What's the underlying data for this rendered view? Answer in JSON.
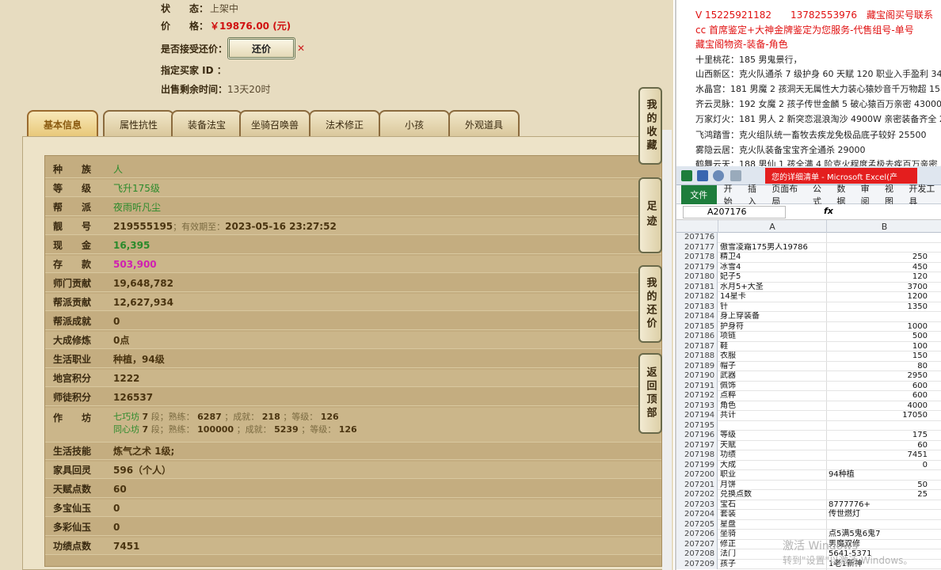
{
  "top": {
    "status_label": "状　　态：",
    "status_value": "上架中",
    "price_label": "价　　格：",
    "price_value": "￥19876.00 (元)",
    "offer_label": "是否接受还价：",
    "offer_button": "还价",
    "buyer_label": "指定买家 ID ：",
    "buyer_value": "",
    "remaining_label": "出售剩余时间：",
    "remaining_value": "13天20时"
  },
  "tabs": [
    "基本信息",
    "属性抗性",
    "装备法宝",
    "坐骑召唤兽",
    "法术修正",
    "小孩",
    "外观道具"
  ],
  "info": {
    "race_label": "种　　族",
    "race": "人",
    "level_label": "等　　级",
    "level": "飞升175级",
    "faction_label": "帮　　派",
    "faction": "夜雨听凡尘",
    "id_label": "靓　　号",
    "id": "219555195",
    "valid_text": "；有效期至：",
    "valid_date": "2023-05-16 23:27:52",
    "cash_label": "现　　金",
    "cash": "16,395",
    "deposit_label": "存　　款",
    "deposit": "503,900",
    "sect_contrib_label": "师门贡献",
    "sect_contrib": "19,648,782",
    "guild_contrib_label": "帮派贡献",
    "guild_contrib": "12,627,934",
    "guild_achieve_label": "帮派成就",
    "guild_achieve": "0",
    "dacheng_label": "大成修炼",
    "dacheng": "0点",
    "life_job_label": "生活职业",
    "life_job": "种植，94级",
    "dungeon_label": "地宫积分",
    "dungeon": "1222",
    "mentor_label": "师徒积分",
    "mentor": "126537",
    "workshop_label": "作　　坊",
    "workshop1_name": "七巧坊",
    "workshop1_lvl": "7",
    "workshop1_seg": "段；熟练：",
    "workshop1_skill": "6287",
    "workshop1_ach_t": "；成就：",
    "workshop1_ach": "218",
    "workshop1_lv_t": "；等级：",
    "workshop1_lv": "126",
    "workshop2_name": "同心坊",
    "workshop2_lvl": "7",
    "workshop2_seg": "段；熟练：",
    "workshop2_skill": "100000",
    "workshop2_ach_t": "；成就：",
    "workshop2_ach": "5239",
    "workshop2_lv_t": "；等级：",
    "workshop2_lv": "126",
    "life_skill_label": "生活技能",
    "life_skill": "炼气之术 1级;",
    "furniture_label": "家具回灵",
    "furniture": "596（个人）",
    "talent_label": "天赋点数",
    "talent": "60",
    "duobao_label": "多宝仙玉",
    "duobao": "0",
    "duocai_label": "多彩仙玉",
    "duocai": "0",
    "merit_label": "功绩点数",
    "merit": "7451"
  },
  "side_buttons": [
    "我的收藏",
    "足迹",
    "我的还价",
    "返回顶部"
  ],
  "doc_lines": [
    {
      "text": "V 15225921182　　13782553976　藏宝阁买号联系",
      "red": true
    },
    {
      "text": "cc 首席鉴定+大神金牌鉴定为您服务-代售组号-单号",
      "red": true
    },
    {
      "text": "藏宝阁物资-装备-角色",
      "red": true
    },
    {
      "text": "十里桃花：185 男鬼景行，",
      "red": false
    },
    {
      "text": "山西新区：克火队通杀 7 级护身 60 天赋 120 职业入手盈利 34500",
      "red": false
    },
    {
      "text": "水晶宫：181 男魔 2 孩洞天无属性大力装心猿妙音千万物超 15800",
      "red": false
    },
    {
      "text": "齐云灵脉：192 女魔 2 孩子传世金麟 5 破心猿百万亲密 43000",
      "red": false
    },
    {
      "text": "万家灯火：181 男人 2 新突恋混浪淘沙 4900W 亲密装备齐全 2300",
      "red": false
    },
    {
      "text": "飞鸿踏雪：克火组队统一畜牧去疾龙免极品底子较好 25500",
      "red": false
    },
    {
      "text": "雾隐云居：克火队装备宝宝齐全通杀 29000",
      "red": false
    },
    {
      "text": "鹤舞云天：188 男仙 1 孩全满 4 阶克火程度孟极去疾百万亲密 539",
      "red": false
    }
  ],
  "excel": {
    "title": "您的详细清单 - Microsoft Excel(产",
    "ribbon": [
      "开始",
      "插入",
      "页面布局",
      "公式",
      "数据",
      "审阅",
      "视图",
      "开发工具"
    ],
    "file_tab": "文件",
    "name_box": "A207176",
    "fx": "fx",
    "col_a": "A",
    "col_b": "B",
    "rows": [
      {
        "n": "207176",
        "a": "",
        "b": ""
      },
      {
        "n": "207177",
        "a": "傲雪凌霜175男人19786",
        "b": ""
      },
      {
        "n": "207178",
        "a": "精卫4",
        "b": "250"
      },
      {
        "n": "207179",
        "a": "冰雪4",
        "b": "450"
      },
      {
        "n": "207180",
        "a": "妃子5",
        "b": "120"
      },
      {
        "n": "207181",
        "a": "水月5+大圣",
        "b": "3700"
      },
      {
        "n": "207182",
        "a": "14星卡",
        "b": "1200"
      },
      {
        "n": "207183",
        "a": "针",
        "b": "1350"
      },
      {
        "n": "207184",
        "a": "身上穿装备",
        "b": ""
      },
      {
        "n": "207185",
        "a": "护身符",
        "b": "1000"
      },
      {
        "n": "207186",
        "a": "项链",
        "b": "500"
      },
      {
        "n": "207187",
        "a": "鞋",
        "b": "100"
      },
      {
        "n": "207188",
        "a": "衣服",
        "b": "150"
      },
      {
        "n": "207189",
        "a": "帽子",
        "b": "80"
      },
      {
        "n": "207190",
        "a": "武器",
        "b": "2950"
      },
      {
        "n": "207191",
        "a": "佩饰",
        "b": "600"
      },
      {
        "n": "207192",
        "a": "点粹",
        "b": "600"
      },
      {
        "n": "207193",
        "a": "角色",
        "b": "4000"
      },
      {
        "n": "207194",
        "a": "共计",
        "b": "17050"
      },
      {
        "n": "207195",
        "a": "",
        "b": ""
      },
      {
        "n": "207196",
        "a": "等级",
        "b": "175"
      },
      {
        "n": "207197",
        "a": "天赋",
        "b": "60"
      },
      {
        "n": "207198",
        "a": "功绩",
        "b": "7451"
      },
      {
        "n": "207199",
        "a": "大成",
        "b": "0"
      },
      {
        "n": "207200",
        "a": "职业",
        "bt": "94种植"
      },
      {
        "n": "207201",
        "a": "月饼",
        "b": "50"
      },
      {
        "n": "207202",
        "a": "兑换点数",
        "b": "25"
      },
      {
        "n": "207203",
        "a": "宝石",
        "bt": "8777776+"
      },
      {
        "n": "207204",
        "a": "套装",
        "bt": "传世燃灯"
      },
      {
        "n": "207205",
        "a": "星盘",
        "b": ""
      },
      {
        "n": "207206",
        "a": "坐骑",
        "bt": "点5满5鬼6鬼7"
      },
      {
        "n": "207207",
        "a": "修正",
        "bt": "男魔双修"
      },
      {
        "n": "207208",
        "a": "法门",
        "bt": "5641-5371"
      },
      {
        "n": "207209",
        "a": "孩子",
        "bt": "1老1新神"
      }
    ]
  },
  "watermark1": "激活 Windows",
  "watermark2": "转到\"设置\"以激活 Windows。",
  "colors": {
    "accent_red": "#e41e1e",
    "excel_green": "#1e7d3c",
    "panel": "#c4ad80"
  }
}
